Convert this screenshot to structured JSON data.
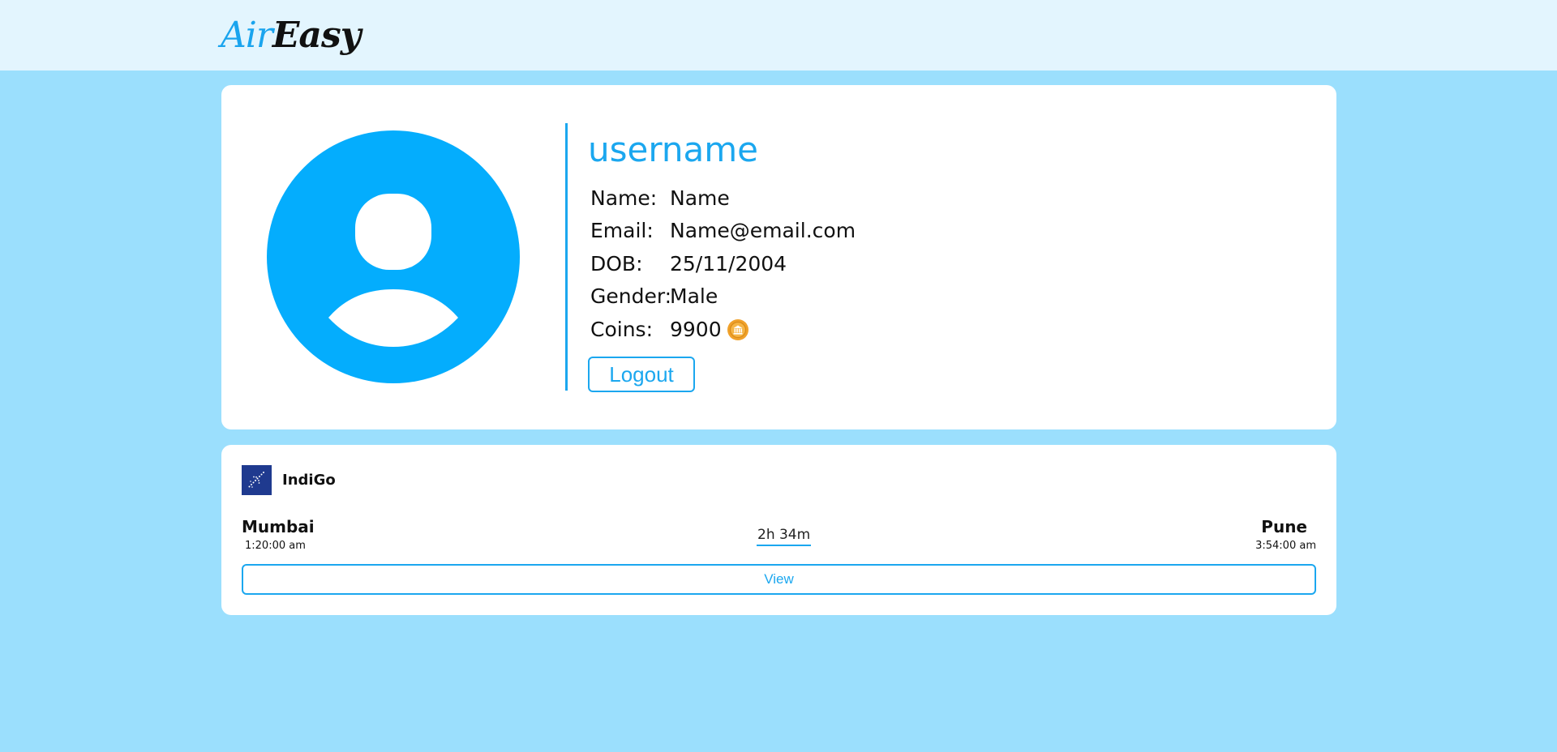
{
  "header": {
    "logo_part1": "Air",
    "logo_part2": "Easy"
  },
  "profile": {
    "username": "username",
    "fields": [
      {
        "label": "Name:",
        "value": "Name"
      },
      {
        "label": "Email:",
        "value": "Name@email.com"
      },
      {
        "label": "DOB:",
        "value": "25/11/2004"
      },
      {
        "label": "Gender:",
        "value": "Male"
      },
      {
        "label": "Coins:",
        "value": "9900"
      }
    ],
    "logout_label": "Logout",
    "avatar_icon": "user-avatar-icon",
    "coin_icon": "coin-icon"
  },
  "flight": {
    "airline": "IndiGo",
    "airline_logo_icon": "indigo-logo-icon",
    "from_city": "Mumbai",
    "from_time": "1:20:00 am",
    "to_city": "Pune",
    "to_time": "3:54:00 am",
    "duration": "2h 34m",
    "view_label": "View"
  },
  "colors": {
    "background": "#9bdffd",
    "topbar": "#e3f5fe",
    "accent": "#1ba7ef",
    "avatar": "#04adfd",
    "coin": "#f0a12a"
  }
}
